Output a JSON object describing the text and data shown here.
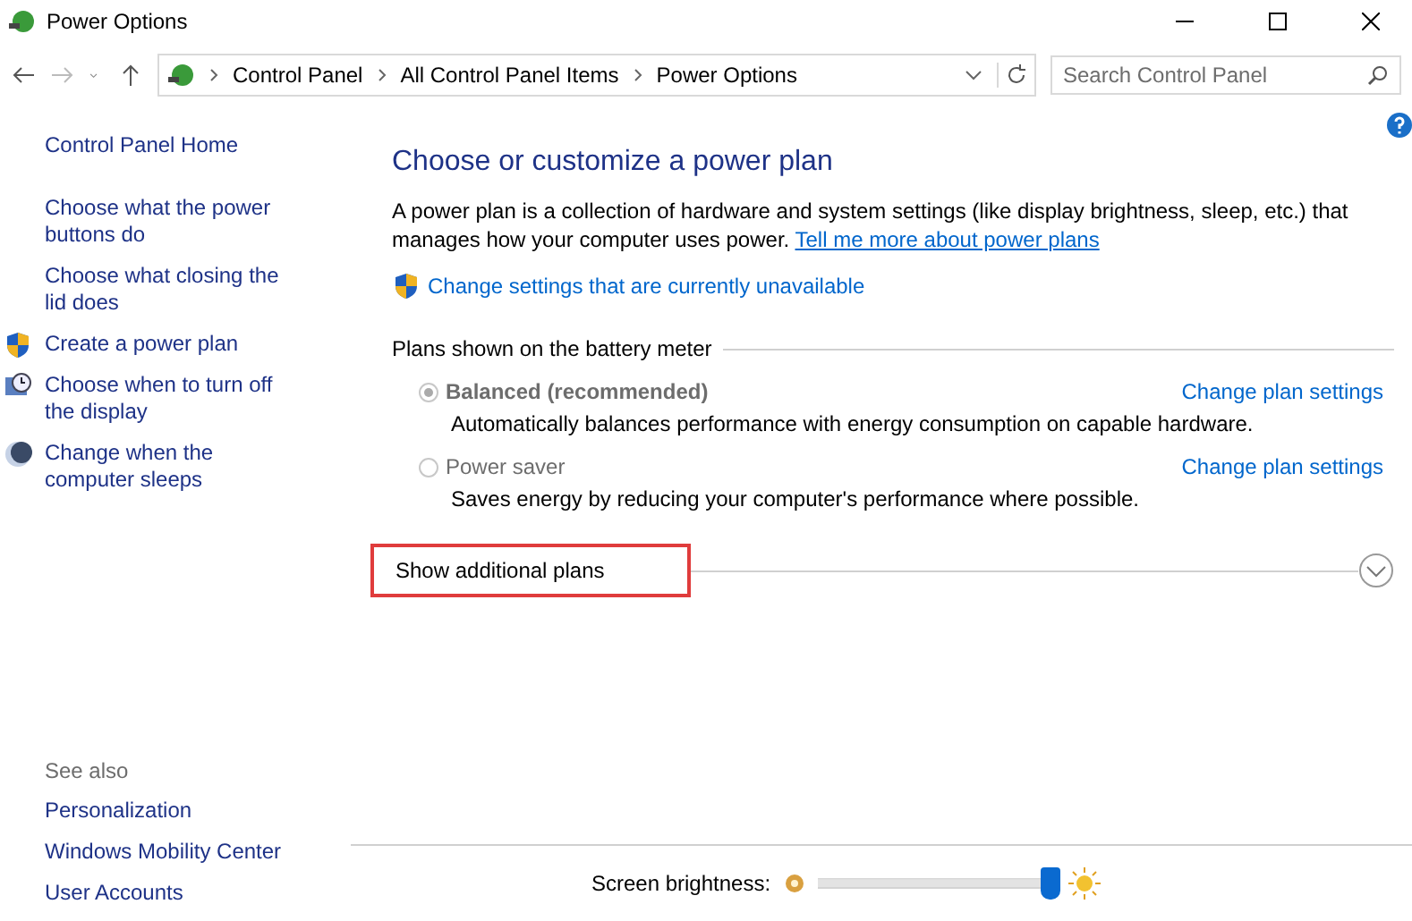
{
  "window": {
    "title": "Power Options"
  },
  "address_bar": {
    "crumbs": [
      "Control Panel",
      "All Control Panel Items",
      "Power Options"
    ]
  },
  "search": {
    "placeholder": "Search Control Panel"
  },
  "sidebar": {
    "home": "Control Panel Home",
    "items": [
      {
        "label": "Choose what the power buttons do",
        "kind": "plain"
      },
      {
        "label": "Choose what closing the lid does",
        "kind": "plain"
      },
      {
        "label": "Create a power plan",
        "kind": "shield"
      },
      {
        "label": "Choose when to turn off the display",
        "kind": "display"
      },
      {
        "label": "Change when the computer sleeps",
        "kind": "sleep"
      }
    ],
    "see_also": {
      "heading": "See also",
      "links": [
        "Personalization",
        "Windows Mobility Center",
        "User Accounts"
      ]
    }
  },
  "content": {
    "title": "Choose or customize a power plan",
    "description": "A power plan is a collection of hardware and system settings (like display brightness, sleep, etc.) that manages how your computer uses power.",
    "description_link": "Tell me more about power plans",
    "settings_link": "Change settings that are currently unavailable",
    "plans_heading": "Plans shown on the battery meter",
    "plans": [
      {
        "name": "Balanced (recommended)",
        "selected": true,
        "description": "Automatically balances performance with energy consumption on capable hardware.",
        "link": "Change plan settings"
      },
      {
        "name": "Power saver",
        "selected": false,
        "description": "Saves energy by reducing your computer's performance where possible.",
        "link": "Change plan settings"
      }
    ],
    "additional": {
      "label": "Show additional plans",
      "expanded": false,
      "highlighted": true
    }
  },
  "brightness": {
    "label": "Screen brightness:",
    "level": 0.97
  }
}
